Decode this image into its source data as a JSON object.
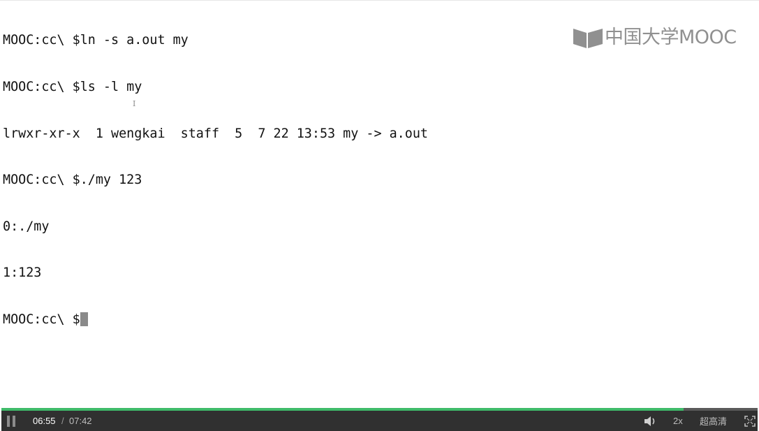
{
  "terminal": {
    "lines": [
      "MOOC:cc\\ $ln -s a.out my",
      "MOOC:cc\\ $ls -l my",
      "lrwxr-xr-x  1 wengkai  staff  5  7 22 13:53 my -> a.out",
      "MOOC:cc\\ $./my 123",
      "0:./my",
      "1:123",
      "MOOC:cc\\ $"
    ]
  },
  "watermark": {
    "text": "中国大学MOOC",
    "icon": "mooc-logo-icon"
  },
  "player": {
    "progress_percent": 90.2,
    "current_time": "06:55",
    "separator": "/",
    "total_time": "07:42",
    "speed": "2x",
    "quality": "超高清",
    "colors": {
      "progress": "#3fba69",
      "bar_bg": "#303030"
    },
    "icons": {
      "pause": "pause-icon",
      "volume": "volume-icon",
      "fullscreen": "fullscreen-icon"
    }
  }
}
